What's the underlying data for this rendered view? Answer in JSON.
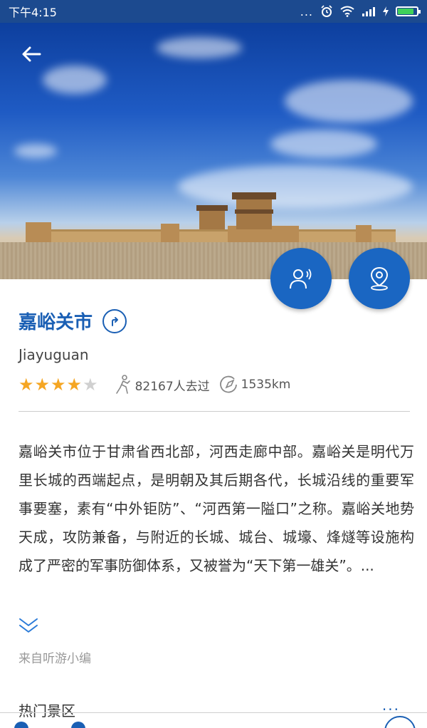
{
  "status_bar": {
    "time": "下午4:15",
    "dots": "...",
    "signal_icon": "signal-icon",
    "wifi_icon": "wifi-icon",
    "alarm_icon": "alarm-icon",
    "battery_icon": "battery-icon"
  },
  "hero": {
    "back_icon": "arrow-left-icon",
    "audio_guide_icon": "person-speaking-icon",
    "map_icon": "location-pin-icon"
  },
  "place": {
    "title": "嘉峪关市",
    "subtitle": "Jiayuguan",
    "rating": 4,
    "rating_max": 5,
    "visitors": "82167人去过",
    "distance": "1535km",
    "visitors_icon": "walker-icon",
    "distance_icon": "compass-icon",
    "share_icon": "share-arrow-icon"
  },
  "description": "嘉峪关市位于甘肃省西北部，河西走廊中部。嘉峪关是明代万里长城的西端起点，是明朝及其后期各代，长城沿线的重要军事要塞，素有“中外钜防”、“河西第一隘口”之称。嘉峪关地势天成，攻防兼备，与附近的长城、城台、城壕、烽燧等设施构成了严密的军事防御体系，又被誉为“天下第一雄关”。...",
  "expand_icon": "double-chevron-down-icon",
  "source": "来自听游小编",
  "section": {
    "title": "热门景区",
    "more": "..."
  },
  "colors": {
    "accent": "#1a5fb4",
    "fab": "#1a66c2",
    "star_on": "#f5a623",
    "star_off": "#d0d0d0",
    "status_bar": "#1c4a8f"
  }
}
